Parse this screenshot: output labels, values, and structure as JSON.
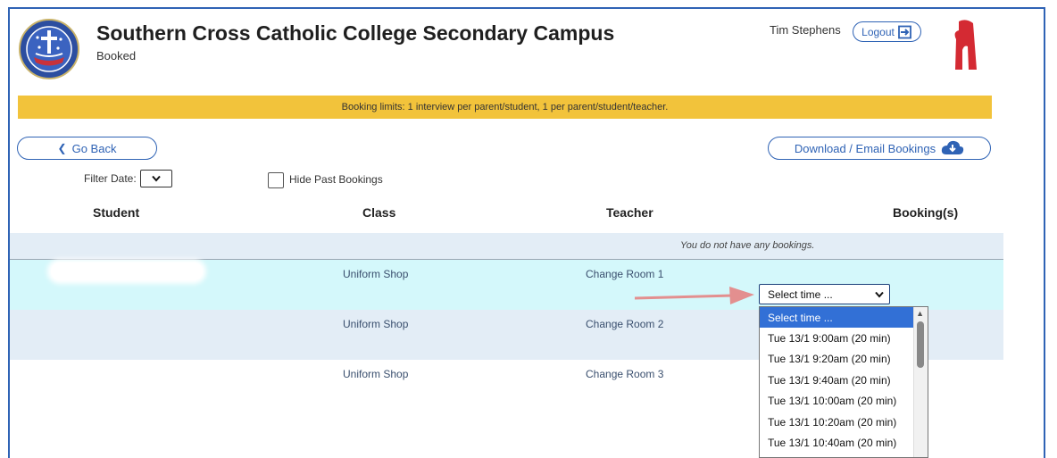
{
  "header": {
    "title": "Southern Cross Catholic College Secondary Campus",
    "subtitle": "Booked",
    "user_name": "Tim Stephens",
    "logout_label": "Logout"
  },
  "banner": {
    "text": "Booking limits: 1 interview per parent/student, 1 per parent/student/teacher."
  },
  "toolbar": {
    "back_label": "Go Back",
    "download_label": "Download / Email Bookings",
    "filter_date_label": "Filter Date:",
    "hide_past_label": "Hide Past Bookings"
  },
  "table": {
    "headers": {
      "student": "Student",
      "class": "Class",
      "teacher": "Teacher",
      "booking": "Booking(s)"
    },
    "empty_message": "You do not have any bookings.",
    "rows": [
      {
        "class": "Uniform Shop",
        "teacher": "Change Room 1"
      },
      {
        "class": "Uniform Shop",
        "teacher": "Change Room 2"
      },
      {
        "class": "Uniform Shop",
        "teacher": "Change Room 3"
      }
    ]
  },
  "time_select": {
    "selected": "Select time ...",
    "options": [
      "Select time ...",
      "Tue 13/1 9:00am (20 min)",
      "Tue 13/1 9:20am (20 min)",
      "Tue 13/1 9:40am (20 min)",
      "Tue 13/1 10:00am (20 min)",
      "Tue 13/1 10:20am (20 min)",
      "Tue 13/1 10:40am (20 min)"
    ]
  },
  "colors": {
    "accent": "#2f63b5",
    "banner": "#f2c33b",
    "row_highlight": "#d4f8fb",
    "row_alt": "#e3edf6",
    "option_selected": "#3270d6",
    "arrow": "#e38f8f"
  }
}
